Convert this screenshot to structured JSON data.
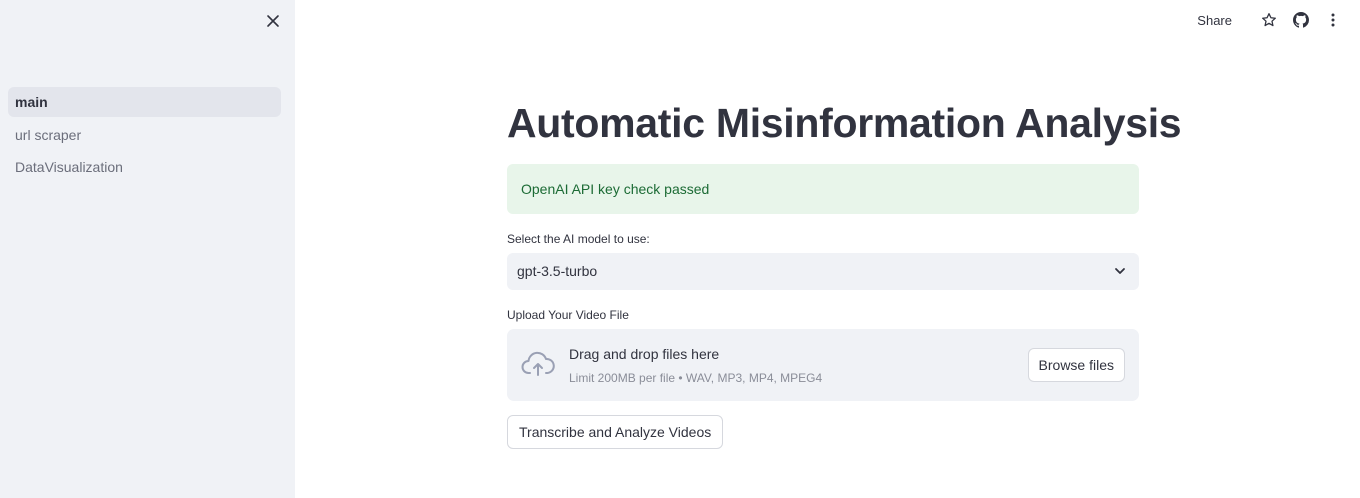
{
  "sidebar": {
    "close_icon": "close-icon",
    "items": [
      {
        "label": "main",
        "active": true
      },
      {
        "label": "url scraper",
        "active": false
      },
      {
        "label": "DataVisualization",
        "active": false
      }
    ]
  },
  "header": {
    "share_label": "Share",
    "icons": [
      "star-icon",
      "github-icon",
      "more-vertical-icon"
    ]
  },
  "main": {
    "title": "Automatic Misinformation Analysis",
    "alert": {
      "text": "OpenAI API key check passed",
      "color": "#1c6b35",
      "background": "#e8f5ea"
    },
    "model_select": {
      "label": "Select the AI model to use:",
      "value": "gpt-3.5-turbo"
    },
    "upload": {
      "label": "Upload Your Video File",
      "drop_title": "Drag and drop files here",
      "drop_subtitle": "Limit 200MB per file • WAV, MP3, MP4, MPEG4",
      "browse_label": "Browse files"
    },
    "action_button": "Transcribe and Analyze Videos"
  }
}
